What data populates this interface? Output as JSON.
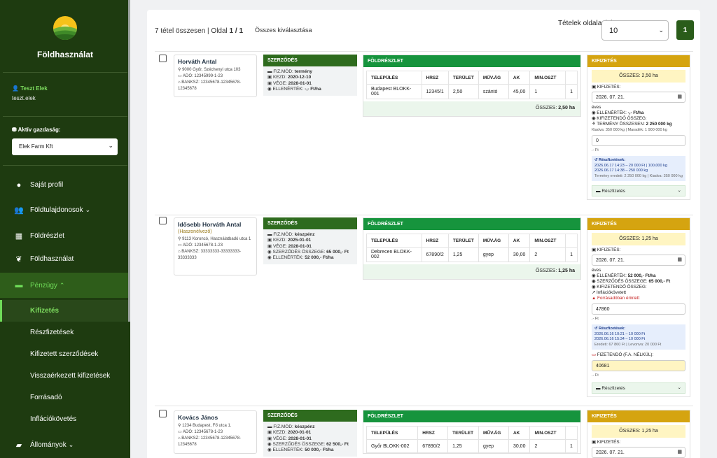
{
  "sidebar": {
    "brand": "Földhasználat",
    "user": {
      "name": "Teszt Elek",
      "email": "teszt.elek"
    },
    "farm": {
      "label": "Aktív gazdaság:",
      "selected": "Elek Farm Kft"
    },
    "nav": [
      {
        "label": "Saját profil",
        "icon": "user-circle-icon"
      },
      {
        "label": "Földtulajdonosok",
        "icon": "users-icon",
        "caret": "chevron-down"
      },
      {
        "label": "Földrészlet",
        "icon": "map-icon"
      },
      {
        "label": "Földhasználat",
        "icon": "seedling-icon"
      },
      {
        "label": "Pénzügy",
        "icon": "money-bill-icon",
        "caret": "chevron-up"
      }
    ],
    "sub": [
      "Kifizetés",
      "Részfizetések",
      "Kifizetett szerződések",
      "Visszaérkezett kifizetések",
      "Forrásadó",
      "Inflációkövetés"
    ],
    "nav_last": {
      "label": "Állományok",
      "icon": "folder-icon"
    }
  },
  "header": {
    "summary_prefix": "7 tétel összesen | Oldal ",
    "summary_page": "1 / 1",
    "select_all": "Összes kiválasztása",
    "per_page_label": "Tételek oldalanként:",
    "per_page_value": "10",
    "page_number": "1"
  },
  "labels": {
    "contract_hd": "SZERZŐDÉS",
    "land_hd": "FÖLDRÉSZLET",
    "payout_hd": "KIFIZETÉS",
    "cols": [
      "TELEPÜLÉS",
      "HRSZ",
      "TERÜLET",
      "MŰV.ÁG",
      "AK",
      "MIN.OSZT"
    ],
    "total": "ÖSSZES:",
    "payout": "KIFIZETÉS:",
    "partial": "Részfizetés",
    "partial_hd": "Részfizetések:",
    "unit_ft": ".- Ft",
    "pay_mode": "FIZ.MÓD:",
    "start": "KEZD:",
    "end": "VÉGE:",
    "value": "ELLENÉRTÉK:",
    "contract_sum": "SZERZŐDÉS ÖSSZEGE:",
    "due": "KIFIZETENDŐ ÖSSZEG:",
    "crop_total": "TERMÉNY ÖSSZESEN:",
    "fa_due": "FIZETENDŐ (F.A. NÉLKÜL):"
  },
  "records": [
    {
      "owner": {
        "name": "Horváth Antal",
        "address": "9000 Győr, Széchenyi utca 103",
        "tax": "ADÓ: 12345999-1-23",
        "bank": "BANKSZ: 12345678-12345678-12345678"
      },
      "contract": {
        "mode": "termény",
        "start": "2020-12-10",
        "end": "2028-01-01",
        "value": "-,- Ft/ha"
      },
      "land": {
        "rows": [
          [
            "Budapest BLOKK-001",
            "12345/1",
            "2,50",
            "szántó",
            "45,00",
            "1",
            "1"
          ]
        ],
        "total": "2,50 ha"
      },
      "payout": {
        "total": "ÖSSZES: 2,50 ha",
        "date": "2026. 07. 21.",
        "freq": "éves",
        "value": "-,- Ft/ha",
        "crop": "2 250 000 kg",
        "crop_detail": "Kiadva: 350 000 kg | Maradék: 1 900 000 kg",
        "input": "0",
        "partials": [
          "2026.06.17 14:23 – 20 000 Ft | 100,000 kg",
          "2026.06.17 14:38 – 250 000 kg"
        ],
        "partials_note": "Termény eredeti: 2 250 000 kg | Kiadva: 350 000 kg"
      }
    },
    {
      "owner": {
        "name": "Idősebb Horváth Antal",
        "tag": "(Haszonélvező)",
        "address": "9113 Koroncó, Használatbadó utca 1",
        "tax": "ADÓ: 12345678-1-23",
        "bank": "BANKSZ: 33333333-33333333-33333333"
      },
      "contract": {
        "mode": "készpénz",
        "start": "2025-01-01",
        "end": "2028-01-01",
        "sum": "65 000,- Ft",
        "value": "52 000,- Ft/ha"
      },
      "land": {
        "rows": [
          [
            "Debrecen BLOKK-002",
            "67890/2",
            "1,25",
            "gyep",
            "30,00",
            "2",
            "1"
          ]
        ],
        "total": "1,25 ha"
      },
      "payout": {
        "total": "ÖSSZES: 1,25 ha",
        "date": "2026. 07. 21.",
        "freq": "éves",
        "value": "52 000,- Ft/ha",
        "sum": "65 000,- Ft",
        "inflation": "Inflációkövetett",
        "tax_warn": "Forrásadóban érintett",
        "input": "47860",
        "partials": [
          "2026.06.16 10:21 – 10 000 Ft",
          "2026.06.16 15:34 – 10 000 Ft"
        ],
        "partials_note": "Eredeti: 67 860 Ft | Levonva: 20 000 Ft",
        "fa_value": "40681"
      }
    },
    {
      "owner": {
        "name": "Kovács János",
        "address": "1234 Budapest, Fő utca 1.",
        "tax": "ADÓ: 12345678-1-23",
        "bank": "BANKSZ: 12345678-12345678-12345678"
      },
      "contract": {
        "mode": "készpénz",
        "start": "2020-01-01",
        "end": "2028-01-01",
        "sum": "62 500,- Ft",
        "value": "50 000,- Ft/ha"
      },
      "land": {
        "rows": [
          [
            "Győr BLOKK-002",
            "67890/2",
            "1,25",
            "gyep",
            "30,00",
            "2",
            "1"
          ]
        ],
        "total": "1,25 ha"
      },
      "payout": {
        "total": "ÖSSZES: 1,25 ha",
        "date": "2026. 07. 21."
      }
    }
  ],
  "colors": {
    "sidebar": "#1e3b10",
    "accent": "#6fdc58",
    "contract": "#2e6b1e",
    "land": "#16943d",
    "payout": "#d5a410"
  }
}
